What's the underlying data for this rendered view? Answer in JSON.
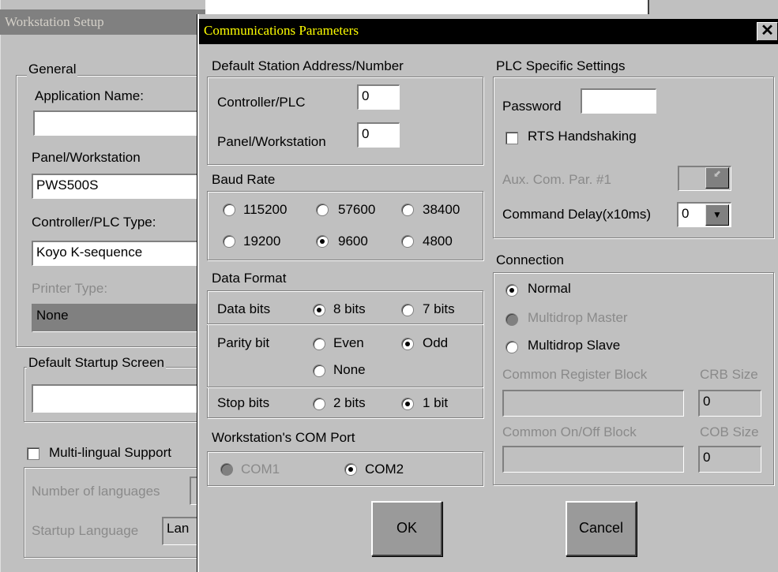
{
  "workstation_setup": {
    "title": "Workstation Setup",
    "general_label": "General",
    "app_name_label": "Application Name:",
    "app_name_value": "",
    "panel_label": "Panel/Workstation",
    "panel_value": "PWS500S",
    "plc_type_label": "Controller/PLC Type:",
    "plc_type_value": "Koyo K-sequence",
    "printer_label": "Printer Type:",
    "printer_value": "None",
    "startup_screen_label": "Default Startup Screen",
    "startup_screen_value": "",
    "multilingual_label": "Multi-lingual Support",
    "num_languages_label": "Number of languages",
    "startup_language_label": "Startup Language",
    "startup_language_value": "Lan"
  },
  "comm_dialog": {
    "title": "Communications Parameters",
    "close_glyph": "✕",
    "station_address": {
      "label": "Default Station Address/Number",
      "controller_label": "Controller/PLC",
      "controller_value": "0",
      "panel_label": "Panel/Workstation",
      "panel_value": "0"
    },
    "baud_rate": {
      "label": "Baud Rate",
      "options": [
        "115200",
        "57600",
        "38400",
        "19200",
        "9600",
        "4800"
      ],
      "selected": "9600"
    },
    "data_format": {
      "label": "Data Format",
      "data_bits_label": "Data bits",
      "data_bits_options": [
        "8 bits",
        "7 bits"
      ],
      "data_bits_selected": "8 bits",
      "parity_label": "Parity bit",
      "parity_options": [
        "Even",
        "Odd",
        "None"
      ],
      "parity_selected": "Odd",
      "stop_bits_label": "Stop bits",
      "stop_bits_options": [
        "2 bits",
        "1 bit"
      ],
      "stop_bits_selected": "1 bit"
    },
    "com_port": {
      "label": "Workstation's COM Port",
      "options": [
        "COM1",
        "COM2"
      ],
      "selected": "COM2"
    },
    "plc_settings": {
      "label": "PLC Specific Settings",
      "password_label": "Password",
      "password_value": "",
      "rts_label": "RTS Handshaking",
      "aux_label": "Aux. Com. Par. #1",
      "command_delay_label": "Command Delay(x10ms)",
      "command_delay_value": "0"
    },
    "connection": {
      "label": "Connection",
      "options": [
        "Normal",
        "Multidrop Master",
        "Multidrop Slave"
      ],
      "selected": "Normal",
      "crb_block_label": "Common Register Block",
      "crb_size_label": "CRB Size",
      "crb_size_value": "0",
      "cob_block_label": "Common On/Off Block",
      "cob_size_label": "COB Size",
      "cob_size_value": "0"
    },
    "ok_label": "OK",
    "cancel_label": "Cancel"
  },
  "icons": [
    "close-icon",
    "dropdown-arrow-icon"
  ]
}
